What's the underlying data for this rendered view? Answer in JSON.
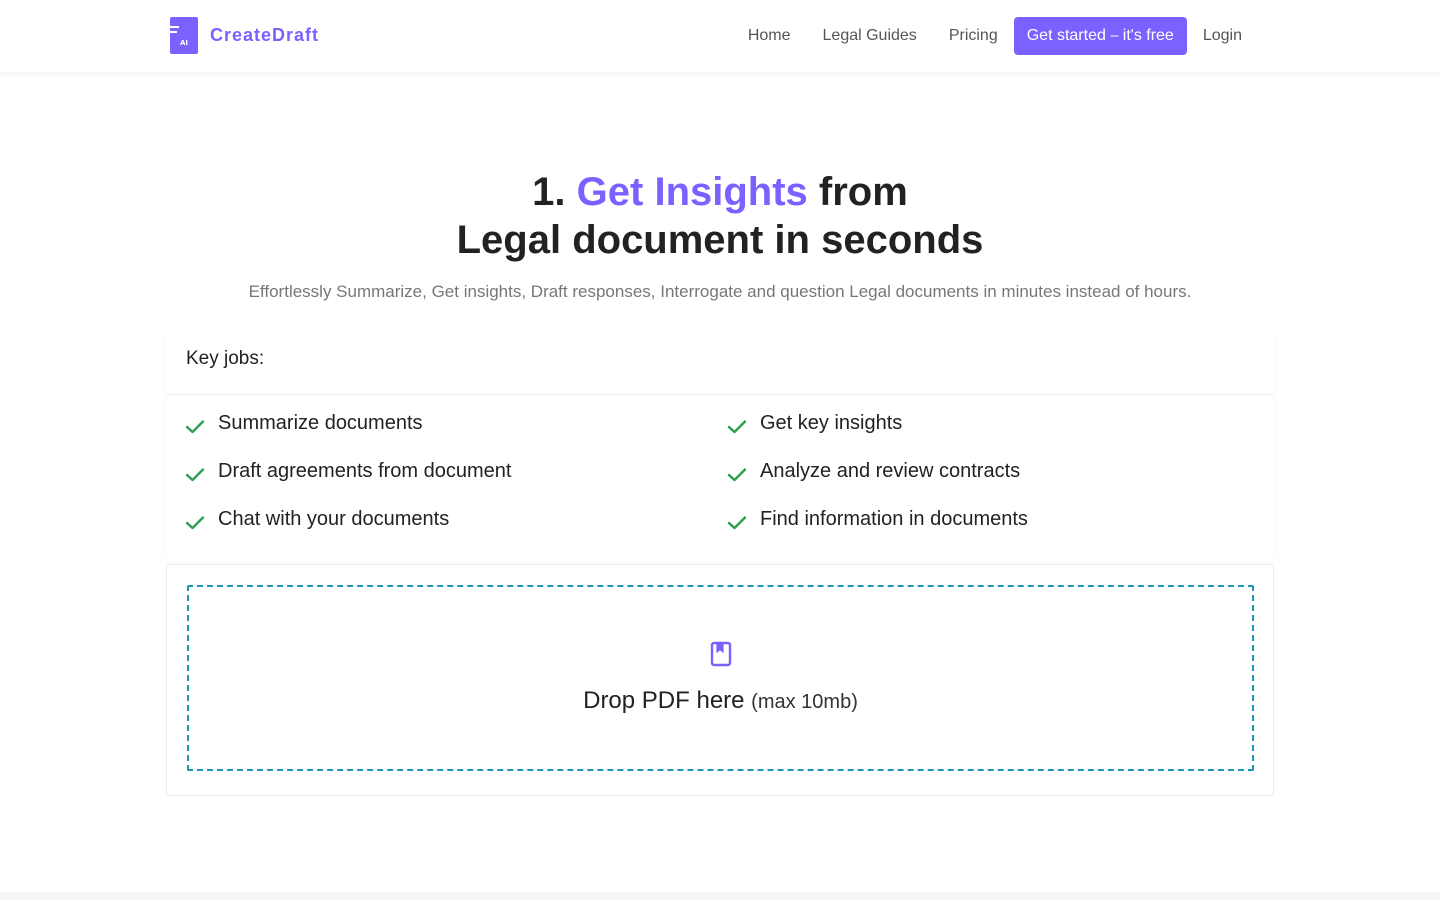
{
  "brand": {
    "name": "CreateDraft",
    "mark_text": "AI",
    "accent_color": "#7b61ff"
  },
  "nav": {
    "home": "Home",
    "guides": "Legal Guides",
    "pricing": "Pricing",
    "cta": "Get started ⎯ it's free",
    "login": "Login"
  },
  "hero": {
    "number": "1.",
    "highlight": "Get Insights",
    "title_end": "from",
    "title_line2": "Legal document in seconds",
    "subtitle": "Effortlessly Summarize, Get insights, Draft responses, Interrogate and question Legal documents in minutes instead of hours."
  },
  "jobs": {
    "header": "Key jobs:",
    "items": [
      "Summarize documents",
      "Get key insights",
      "Draft agreements from document",
      "Analyze and review contracts",
      "Chat with your documents",
      "Find information in documents"
    ],
    "check_color": "#2e9e4f"
  },
  "upload": {
    "label": "Drop PDF here",
    "limit": "(max 10mb)",
    "icon": "document-icon",
    "border_color": "#1b96b5"
  }
}
